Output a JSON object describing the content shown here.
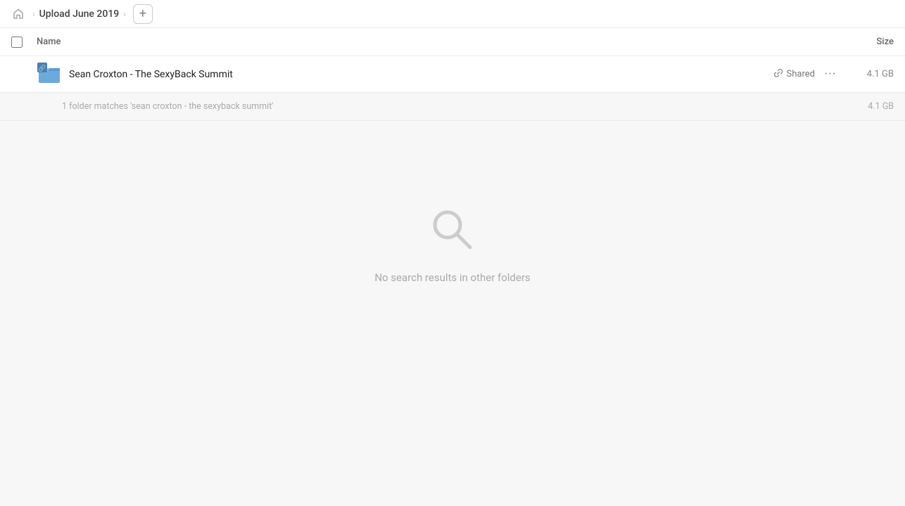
{
  "topbar": {
    "home_label": "Home",
    "breadcrumb_label": "Upload June 2019",
    "add_button_label": "+"
  },
  "table": {
    "name_header": "Name",
    "size_header": "Size",
    "rows": [
      {
        "name": "Sean Croxton - The SexyBack Summit",
        "shared_label": "Shared",
        "size": "4.1 GB"
      }
    ]
  },
  "match_info": {
    "text": "1 folder matches 'sean croxton - the sexyback summit'",
    "size": "4.1 GB"
  },
  "empty_state": {
    "text": "No search results in other folders"
  },
  "icons": {
    "home": "🏠",
    "add": "+",
    "link": "🔗",
    "more": "···",
    "search": "search-icon"
  },
  "colors": {
    "accent": "#4a90e2",
    "folder_blue": "#5b9bd5",
    "text_primary": "#222",
    "text_secondary": "#666",
    "text_muted": "#aaa",
    "border": "#ebebeb",
    "background": "#f7f7f8"
  }
}
